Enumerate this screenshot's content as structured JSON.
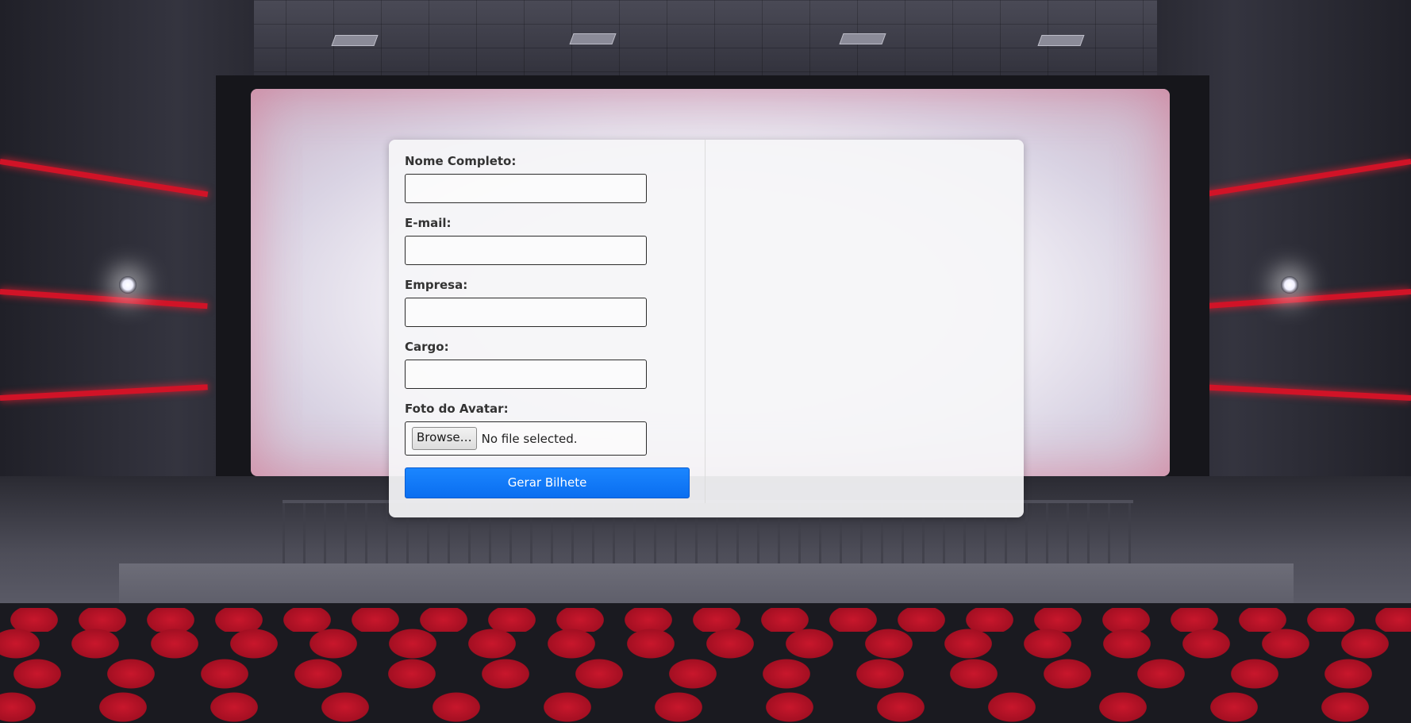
{
  "form": {
    "fields": [
      {
        "label": "Nome Completo:",
        "value": ""
      },
      {
        "label": "E-mail:",
        "value": ""
      },
      {
        "label": "Empresa:",
        "value": ""
      },
      {
        "label": "Cargo:",
        "value": ""
      }
    ],
    "avatar": {
      "label": "Foto do Avatar:",
      "browse_label": "Browse…",
      "status": "No file selected."
    },
    "submit_label": "Gerar Bilhete"
  },
  "colors": {
    "accent": "#0a6ef0",
    "seat_red": "#c8172c",
    "label_text": "#333333"
  }
}
